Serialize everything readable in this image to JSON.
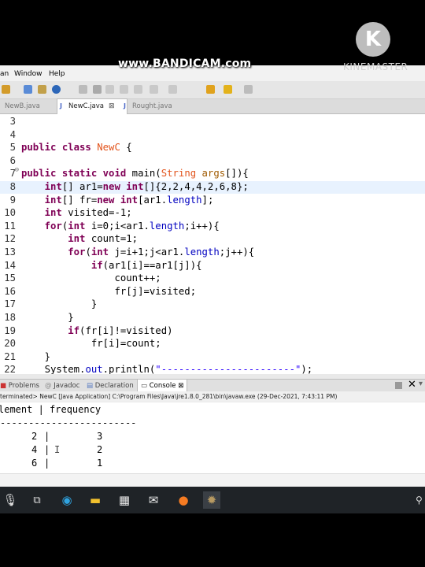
{
  "overlay": {
    "bandicam_text": "www.BANDICAM.com",
    "kinemaster_letter": "K",
    "kinemaster_text": "KINEMASTER"
  },
  "menu": {
    "items": [
      "an",
      "Window",
      "Help"
    ]
  },
  "tabs": [
    {
      "label": "NewB.java",
      "active": false
    },
    {
      "label": "NewC.java",
      "active": true,
      "close": "⊠"
    },
    {
      "label": "Rought.java",
      "active": false
    }
  ],
  "editor": {
    "lines": [
      {
        "n": "3",
        "tokens": []
      },
      {
        "n": "4",
        "tokens": []
      },
      {
        "n": "5",
        "tokens": [
          {
            "t": "public class ",
            "c": "kw"
          },
          {
            "t": "NewC",
            "c": "cls"
          },
          {
            "t": " {",
            "c": ""
          }
        ]
      },
      {
        "n": "6",
        "tokens": []
      },
      {
        "n": "7",
        "marker": "⊖",
        "tokens": [
          {
            "t": "public static void ",
            "c": "kw"
          },
          {
            "t": "main(",
            "c": ""
          },
          {
            "t": "String",
            "c": "cls"
          },
          {
            "t": " ",
            "c": ""
          },
          {
            "t": "args",
            "c": "prm"
          },
          {
            "t": "[]){",
            "c": ""
          }
        ]
      },
      {
        "n": "8",
        "highlight": true,
        "tokens": [
          {
            "t": "    int",
            "c": "kw"
          },
          {
            "t": "[] ar1=",
            "c": ""
          },
          {
            "t": "new ",
            "c": "kw"
          },
          {
            "t": "int",
            "c": "kw"
          },
          {
            "t": "[]{2,2,4,4,2,6,8};",
            "c": ""
          }
        ]
      },
      {
        "n": "9",
        "tokens": [
          {
            "t": "    int",
            "c": "kw"
          },
          {
            "t": "[] fr=",
            "c": ""
          },
          {
            "t": "new ",
            "c": "kw"
          },
          {
            "t": "int",
            "c": "kw"
          },
          {
            "t": "[ar1.",
            "c": ""
          },
          {
            "t": "length",
            "c": "fld"
          },
          {
            "t": "];",
            "c": ""
          }
        ]
      },
      {
        "n": "10",
        "tokens": [
          {
            "t": "    int",
            "c": "kw"
          },
          {
            "t": " visited=-1;",
            "c": ""
          }
        ]
      },
      {
        "n": "11",
        "tokens": [
          {
            "t": "    for",
            "c": "kw"
          },
          {
            "t": "(",
            "c": ""
          },
          {
            "t": "int",
            "c": "kw"
          },
          {
            "t": " i=0;i<ar1.",
            "c": ""
          },
          {
            "t": "length",
            "c": "fld"
          },
          {
            "t": ";i++){",
            "c": ""
          }
        ]
      },
      {
        "n": "12",
        "tokens": [
          {
            "t": "        int",
            "c": "kw"
          },
          {
            "t": " count=1;",
            "c": ""
          }
        ]
      },
      {
        "n": "13",
        "tokens": [
          {
            "t": "        for",
            "c": "kw"
          },
          {
            "t": "(",
            "c": ""
          },
          {
            "t": "int",
            "c": "kw"
          },
          {
            "t": " j=i+1;j<ar1.",
            "c": ""
          },
          {
            "t": "length",
            "c": "fld"
          },
          {
            "t": ";j++){",
            "c": ""
          }
        ]
      },
      {
        "n": "14",
        "tokens": [
          {
            "t": "            if",
            "c": "kw"
          },
          {
            "t": "(ar1[i]==ar1[j]){",
            "c": ""
          }
        ]
      },
      {
        "n": "15",
        "tokens": [
          {
            "t": "                count++;",
            "c": ""
          }
        ]
      },
      {
        "n": "16",
        "tokens": [
          {
            "t": "                fr[j]=visited;",
            "c": ""
          }
        ]
      },
      {
        "n": "17",
        "tokens": [
          {
            "t": "            }",
            "c": ""
          }
        ]
      },
      {
        "n": "18",
        "tokens": [
          {
            "t": "        }",
            "c": ""
          }
        ]
      },
      {
        "n": "19",
        "tokens": [
          {
            "t": "        if",
            "c": "kw"
          },
          {
            "t": "(fr[i]!=visited)",
            "c": ""
          }
        ]
      },
      {
        "n": "20",
        "tokens": [
          {
            "t": "            fr[i]=count;",
            "c": ""
          }
        ]
      },
      {
        "n": "21",
        "tokens": [
          {
            "t": "    }",
            "c": ""
          }
        ]
      },
      {
        "n": "22",
        "tokens": [
          {
            "t": "    System.",
            "c": ""
          },
          {
            "t": "out",
            "c": "fld"
          },
          {
            "t": ".println(",
            "c": ""
          },
          {
            "t": "\"-----------------------\"",
            "c": "str"
          },
          {
            "t": ");",
            "c": ""
          }
        ]
      }
    ]
  },
  "panel": {
    "tabs": [
      "Problems",
      "Javadoc",
      "Declaration",
      "Console"
    ],
    "active": "Console",
    "console_close": "⊠",
    "status": "terminated> NewC [Java Application] C:\\Program Files\\Java\\jre1.8.0_281\\bin\\javaw.exe (29-Dec-2021, 7:43:11 PM)"
  },
  "console": {
    "header": "lement | frequency",
    "separator": "------------------------",
    "rows": [
      {
        "element": "2",
        "frequency": "3"
      },
      {
        "element": "4",
        "frequency": "2"
      },
      {
        "element": "6",
        "frequency": "1"
      }
    ]
  },
  "colors": {
    "keyword": "#7f0055",
    "class": "#e2531b",
    "param": "#a05a00",
    "field": "#0000c0",
    "string": "#2a00ff",
    "taskbar": "#1f2327"
  },
  "taskbar": {
    "icons": [
      "microphone-icon",
      "task-view-icon",
      "edge-icon",
      "file-explorer-icon",
      "store-icon",
      "mail-icon",
      "firefox-icon",
      "eclipse-icon"
    ]
  }
}
